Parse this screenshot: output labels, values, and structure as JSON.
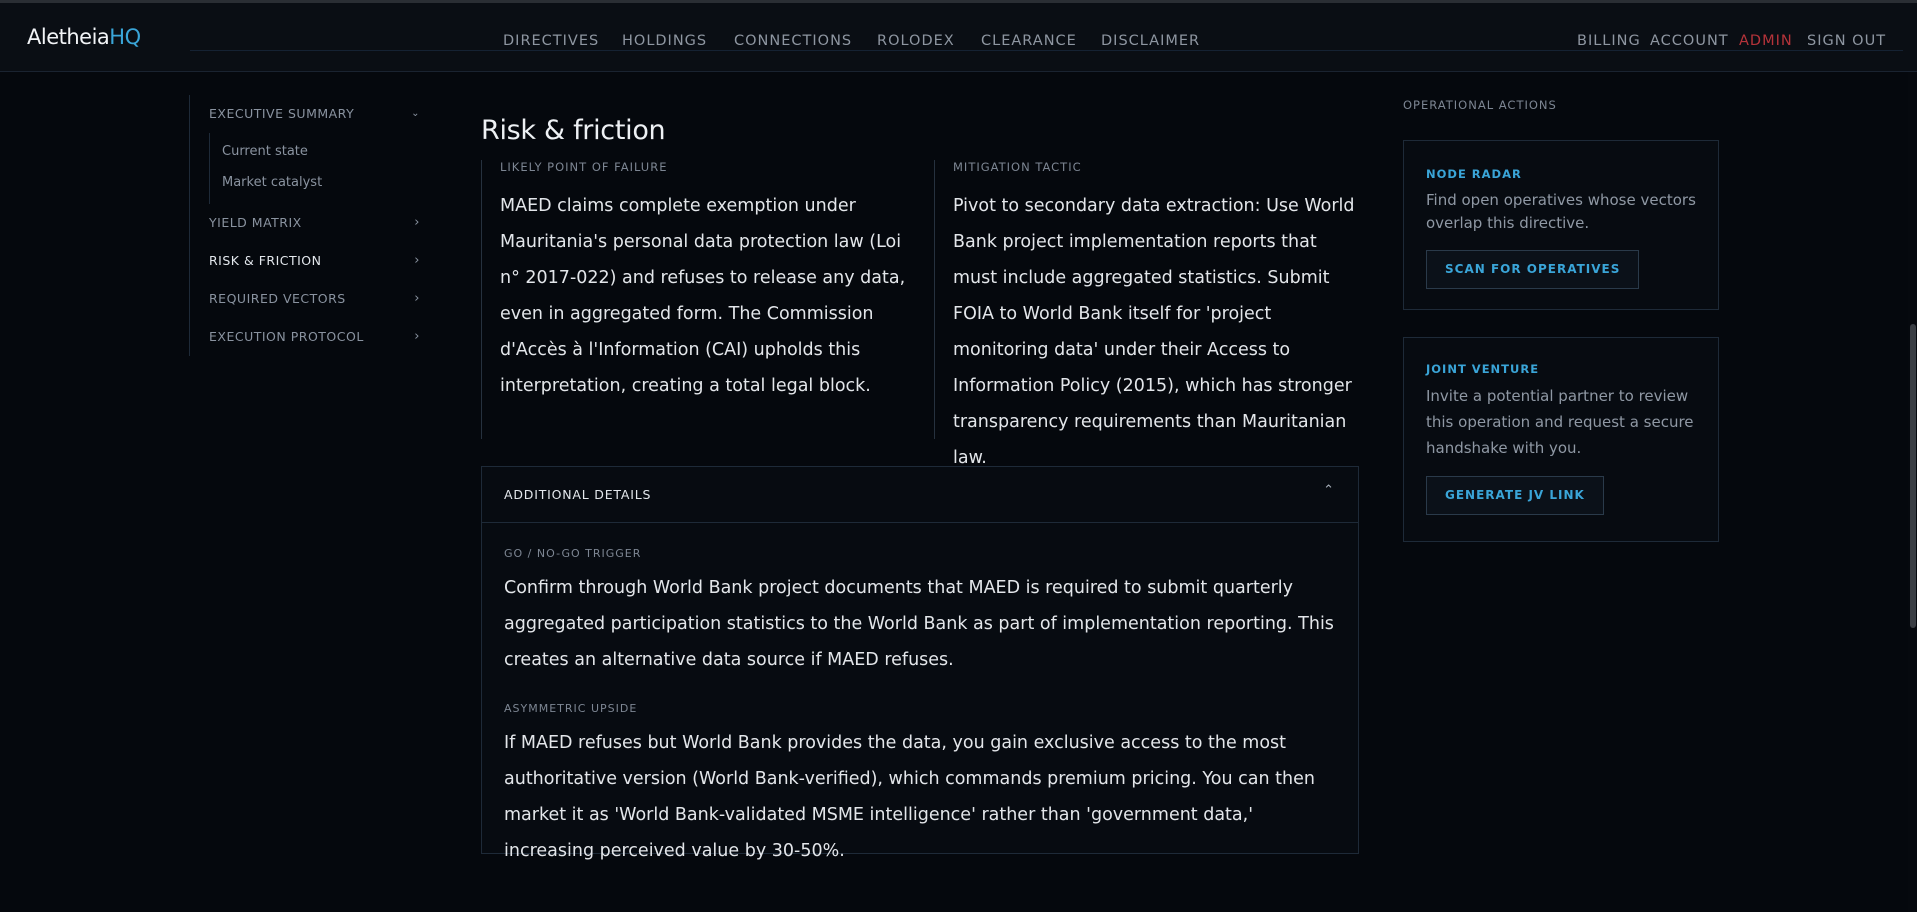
{
  "header": {
    "brand_main": "Aletheia",
    "brand_accent": "HQ",
    "nav": [
      "DIRECTIVES",
      "HOLDINGS",
      "CONNECTIONS",
      "ROLODEX",
      "CLEARANCE",
      "DISCLAIMER"
    ],
    "account_nav": {
      "billing": "BILLING",
      "account": "ACCOUNT",
      "admin": "ADMIN",
      "sign_out": "SIGN OUT"
    }
  },
  "sidebar": {
    "items": [
      {
        "label": "EXECUTIVE SUMMARY",
        "expanded": true,
        "children": [
          "Current state",
          "Market catalyst"
        ]
      },
      {
        "label": "YIELD MATRIX"
      },
      {
        "label": "RISK & FRICTION",
        "active": true
      },
      {
        "label": "REQUIRED VECTORS"
      },
      {
        "label": "EXECUTION PROTOCOL"
      }
    ]
  },
  "main": {
    "title": "Risk & friction",
    "failure": {
      "label": "LIKELY POINT OF FAILURE",
      "text": "MAED claims complete exemption under Mauritania's personal data protection law (Loi n° 2017-022) and refuses to release any data, even in aggregated form. The Commission d'Accès à l'Information (CAI) upholds this interpretation, creating a total legal block."
    },
    "mitigation": {
      "label": "MITIGATION TACTIC",
      "text": "Pivot to secondary data extraction: Use World Bank project implementation reports that must include aggregated statistics. Submit FOIA to World Bank itself for 'project monitoring data' under their Access to Information Policy (2015), which has stronger transparency requirements than Mauritanian law."
    },
    "details": {
      "header": "ADDITIONAL DETAILS",
      "trigger_label": "GO / NO-GO TRIGGER",
      "trigger_text": "Confirm through World Bank project documents that MAED is required to submit quarterly aggregated participation statistics to the World Bank as part of implementation reporting. This creates an alternative data source if MAED refuses.",
      "upside_label": "ASYMMETRIC UPSIDE",
      "upside_text": "If MAED refuses but World Bank provides the data, you gain exclusive access to the most authoritative version (World Bank-verified), which commands premium pricing. You can then market it as 'World Bank-validated MSME intelligence' rather than 'government data,' increasing perceived value by 30-50%."
    }
  },
  "rail": {
    "label": "OPERATIONAL ACTIONS",
    "node_radar": {
      "title": "NODE RADAR",
      "desc": "Find open operatives whose vectors overlap this directive.",
      "button": "SCAN FOR OPERATIVES"
    },
    "joint_venture": {
      "title": "JOINT VENTURE",
      "desc": "Invite a potential partner to review this operation and request a secure handshake with you.",
      "button": "GENERATE JV LINK"
    }
  },
  "colors": {
    "accent": "#3aa5d8",
    "admin": "#b5333a",
    "background": "#05080d"
  }
}
